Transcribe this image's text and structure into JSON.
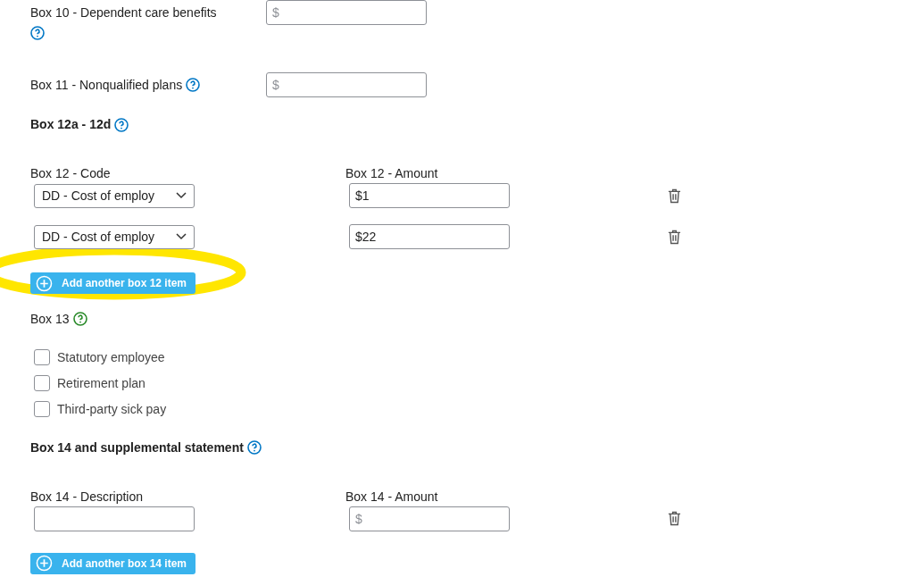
{
  "fields_top": [
    {
      "label": "Box 10 - Dependent care benefits",
      "placeholder": "$"
    },
    {
      "label": "Box 11 - Nonqualified plans",
      "placeholder": "$"
    }
  ],
  "box12": {
    "heading": "Box 12a - 12d",
    "code_label": "Box 12 - Code",
    "amount_label": "Box 12 - Amount",
    "rows": [
      {
        "code": "DD - Cost of employ",
        "amount": "$1"
      },
      {
        "code": "DD - Cost of employ",
        "amount": "$22"
      }
    ],
    "add_button": "Add another box 12 item"
  },
  "box13": {
    "heading": "Box 13",
    "options": [
      {
        "label": "Statutory employee",
        "checked": false
      },
      {
        "label": "Retirement plan",
        "checked": false
      },
      {
        "label": "Third-party sick pay",
        "checked": false
      }
    ]
  },
  "box14": {
    "heading": "Box 14 and supplemental statement",
    "description_label": "Box 14 - Description",
    "amount_label": "Box 14 - Amount",
    "rows": [
      {
        "description": "",
        "amount_placeholder": "$"
      }
    ],
    "add_button": "Add another box 14 item"
  },
  "annotation": {
    "kind": "highlight"
  }
}
